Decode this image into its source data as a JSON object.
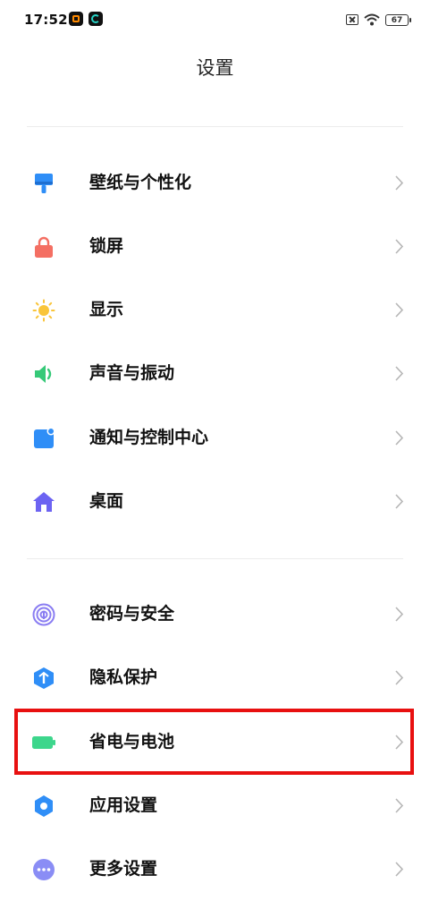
{
  "status_bar": {
    "time": "17:52",
    "battery": "67"
  },
  "title": "设置",
  "groups": [
    {
      "items": [
        {
          "label": "壁纸与个性化",
          "icon": "wallpaper-brush-icon",
          "color": "#2f8ef7"
        },
        {
          "label": "锁屏",
          "icon": "lock-icon",
          "color": "#f46f63"
        },
        {
          "label": "显示",
          "icon": "sun-icon",
          "color": "#f9c53a"
        },
        {
          "label": "声音与振动",
          "icon": "speaker-icon",
          "color": "#36c978"
        },
        {
          "label": "通知与控制中心",
          "icon": "notification-icon",
          "color": "#2f8ef7"
        },
        {
          "label": "桌面",
          "icon": "home-icon",
          "color": "#6c63f2"
        }
      ]
    },
    {
      "items": [
        {
          "label": "密码与安全",
          "icon": "fingerprint-icon",
          "color": "#8a7df2"
        },
        {
          "label": "隐私保护",
          "icon": "privacy-shield-icon",
          "color": "#2f8ef7"
        },
        {
          "label": "省电与电池",
          "icon": "battery-icon",
          "color": "#3dd68c"
        },
        {
          "label": "应用设置",
          "icon": "gear-icon",
          "color": "#2f8ef7"
        },
        {
          "label": "更多设置",
          "icon": "more-dots-icon",
          "color": "#8a8df5"
        }
      ]
    }
  ],
  "highlight_color": "#e81010"
}
